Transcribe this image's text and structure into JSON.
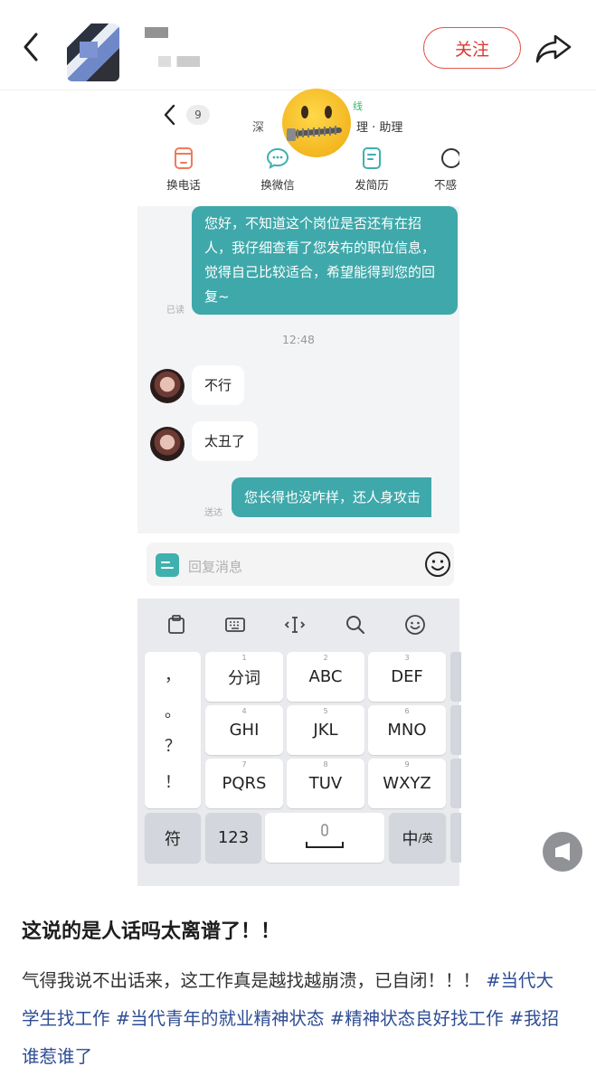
{
  "topbar": {
    "follow_label": "关注"
  },
  "chat": {
    "unread_badge": "9",
    "header_title_left": "深",
    "header_title_right": "理 · 助理",
    "header_status": "线",
    "actions": [
      {
        "label": "换电话",
        "icon": "phone-icon"
      },
      {
        "label": "换微信",
        "icon": "wechat-icon"
      },
      {
        "label": "发简历",
        "icon": "resume-icon"
      },
      {
        "label": "不感",
        "icon": "not-interested-icon"
      }
    ],
    "messages": [
      {
        "from": "me",
        "text": "您好，不知道这个岗位是否还有在招人，我仔细查看了您发布的职位信息，觉得自己比较适合，希望能得到您的回复~",
        "status": "已读"
      },
      {
        "from": "system",
        "text": "12:48"
      },
      {
        "from": "them",
        "text": "不行"
      },
      {
        "from": "them",
        "text": "太丑了"
      },
      {
        "from": "me",
        "text": "您长得也没咋样，还人身攻击",
        "status": "送达"
      }
    ],
    "input_placeholder": "回复消息"
  },
  "keyboard": {
    "punctuation": [
      "，",
      "。",
      "？",
      "！"
    ],
    "rows": [
      [
        {
          "num": "1",
          "label": "分词"
        },
        {
          "num": "2",
          "label": "ABC"
        },
        {
          "num": "3",
          "label": "DEF"
        }
      ],
      [
        {
          "num": "4",
          "label": "GHI"
        },
        {
          "num": "5",
          "label": "JKL"
        },
        {
          "num": "6",
          "label": "MNO"
        }
      ],
      [
        {
          "num": "7",
          "label": "PQRS"
        },
        {
          "num": "8",
          "label": "TUV"
        },
        {
          "num": "9",
          "label": "WXYZ"
        }
      ]
    ],
    "bottom": {
      "symbols": "符",
      "numbers": "123",
      "lang_main": "中",
      "lang_sub": "/英"
    },
    "toolbar_icons": [
      "clipboard-icon",
      "keyboard-icon",
      "cursor-icon",
      "search-icon",
      "emoji-icon"
    ]
  },
  "post": {
    "title": "这说的是人话吗太离谱了！！",
    "body_text": "气得我说不出话来，这工作真是越找越崩溃，已自闭！！！",
    "tags": [
      "#当代大学生找工作",
      "#当代青年的就业精神状态",
      "#精神状态良好找工作",
      "#我招谁惹谁了"
    ]
  },
  "colors": {
    "accent_red": "#d83a34",
    "chat_teal": "#3fa8aa",
    "tag_blue": "#2e4d94"
  }
}
